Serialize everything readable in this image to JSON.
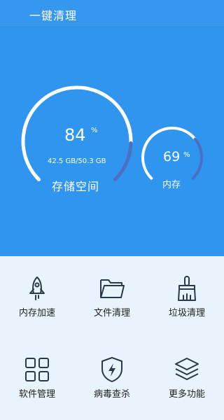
{
  "app": {
    "title": "一键清理"
  },
  "storage": {
    "percent": "84",
    "percent_sign": "%",
    "usage": "42.5 GB/50.3 GB",
    "label": "存储空间",
    "fraction": 0.84
  },
  "memory": {
    "percent": "69",
    "percent_sign": "%",
    "label": "内存",
    "fraction": 0.69
  },
  "colors": {
    "header_bg": "#2f95ef",
    "ring_track": "#ffffff",
    "ring_progress": "#4b6fc4",
    "icon": "#2a3a4a"
  },
  "features": [
    {
      "label": "内存加速",
      "icon": "rocket-icon"
    },
    {
      "label": "文件清理",
      "icon": "folder-icon"
    },
    {
      "label": "垃圾清理",
      "icon": "broom-icon"
    },
    {
      "label": "软件管理",
      "icon": "apps-grid-icon"
    },
    {
      "label": "病毒查杀",
      "icon": "shield-lightning-icon"
    },
    {
      "label": "更多功能",
      "icon": "layers-icon"
    }
  ]
}
